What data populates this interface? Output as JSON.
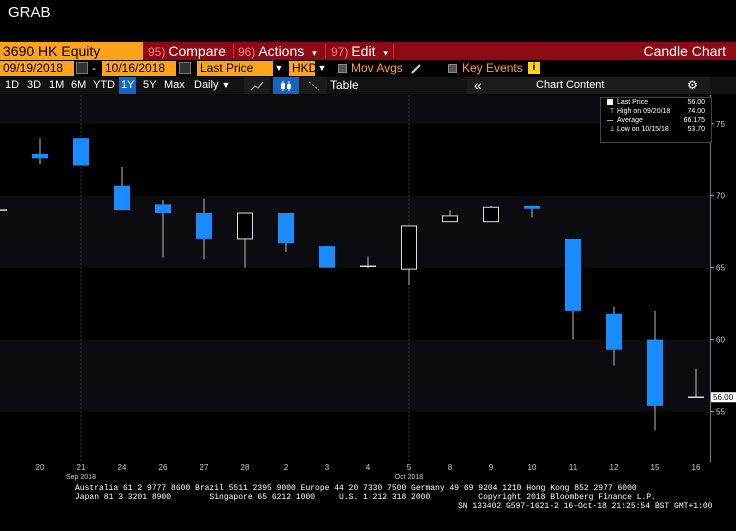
{
  "window": {
    "title": "GRAB"
  },
  "toolbar": {
    "ticker": "3690 HK Equity",
    "menus": [
      {
        "num": "95)",
        "label": "Compare"
      },
      {
        "num": "96)",
        "label": "Actions",
        "caret": "▾"
      },
      {
        "num": "97)",
        "label": "Edit",
        "caret": "▾"
      }
    ],
    "chart_type": "Candle Chart"
  },
  "settings": {
    "start_date": "09/19/2018",
    "end_date": "10/16/2018",
    "date_sep": "-",
    "field": "Last Price",
    "currency": "HKD",
    "mov_avgs": "Mov Avgs",
    "key_events": "Key Events",
    "info_icon": "i"
  },
  "periods": [
    "1D",
    "3D",
    "1M",
    "6M",
    "YTD",
    "1Y",
    "5Y",
    "Max"
  ],
  "selected_period": "1Y",
  "frequency": "Daily",
  "frequency_caret": "▼",
  "table_label": "Table",
  "collapse_icon": "«",
  "chart_content": "Chart Content",
  "gear_icon": "⚙",
  "legend": {
    "rows": [
      {
        "label": "Last Price",
        "value": "56.00"
      },
      {
        "label": "High on 09/20/18",
        "value": "74.00"
      },
      {
        "label": "Average",
        "value": "66.175"
      },
      {
        "label": "Low on 10/15/18",
        "value": "53.70"
      }
    ]
  },
  "chart_data": {
    "type": "candlestick",
    "currency": "HKD",
    "ylim": [
      51.5,
      77
    ],
    "yticks": [
      55,
      60,
      65,
      70,
      75
    ],
    "last_price_label": "56.00",
    "month_labels": [
      {
        "label": "Sep 2018",
        "at_index": 2
      },
      {
        "label": "Oct 2018",
        "at_index": 10
      }
    ],
    "candles": [
      {
        "x": "19",
        "open": 69.0,
        "close": 69.0,
        "high": 69.0,
        "low": 69.0,
        "color": "flat"
      },
      {
        "x": "20",
        "open": 72.9,
        "close": 72.6,
        "high": 74.0,
        "low": 72.2,
        "color": "blue"
      },
      {
        "x": "21",
        "open": 74.0,
        "close": 72.1,
        "high": 74.0,
        "low": 72.1,
        "color": "blue"
      },
      {
        "x": "24",
        "open": 70.7,
        "close": 69.0,
        "high": 72.0,
        "low": 69.0,
        "color": "blue"
      },
      {
        "x": "26",
        "open": 69.4,
        "close": 68.8,
        "high": 69.7,
        "low": 65.7,
        "color": "blue"
      },
      {
        "x": "27",
        "open": 68.8,
        "close": 67.0,
        "high": 69.8,
        "low": 65.6,
        "color": "blue"
      },
      {
        "x": "28",
        "open": 67.0,
        "close": 68.8,
        "high": 68.8,
        "low": 65.0,
        "color": "white"
      },
      {
        "x": "2",
        "open": 68.8,
        "close": 66.7,
        "high": 68.8,
        "low": 66.1,
        "color": "blue"
      },
      {
        "x": "3",
        "open": 66.5,
        "close": 65.0,
        "high": 66.5,
        "low": 65.0,
        "color": "blue"
      },
      {
        "x": "4",
        "open": 65.1,
        "close": 65.1,
        "high": 65.8,
        "low": 65.0,
        "color": "flat"
      },
      {
        "x": "5",
        "open": 64.9,
        "close": 67.9,
        "high": 67.9,
        "low": 63.8,
        "color": "white"
      },
      {
        "x": "8",
        "open": 68.2,
        "close": 68.6,
        "high": 69.0,
        "low": 68.2,
        "color": "white"
      },
      {
        "x": "9",
        "open": 68.2,
        "close": 69.2,
        "high": 69.3,
        "low": 68.2,
        "color": "white"
      },
      {
        "x": "10",
        "open": 69.3,
        "close": 69.1,
        "high": 69.3,
        "low": 68.5,
        "color": "blue"
      },
      {
        "x": "11",
        "open": 67.0,
        "close": 62.0,
        "high": 67.0,
        "low": 60.0,
        "color": "blue"
      },
      {
        "x": "12",
        "open": 61.8,
        "close": 59.3,
        "high": 62.3,
        "low": 58.2,
        "color": "blue"
      },
      {
        "x": "15",
        "open": 60.0,
        "close": 55.4,
        "high": 62.0,
        "low": 53.7,
        "color": "blue"
      },
      {
        "x": "16",
        "open": 56.0,
        "close": 56.0,
        "high": 58.0,
        "low": 56.0,
        "color": "flat"
      }
    ]
  },
  "colors": {
    "blue": "#1a8cff",
    "orange": "#ffa31a",
    "maroon": "#8b0a14"
  },
  "footer": {
    "line1": "Australia 61 2 9777 8600 Brazil 5511 2395 9000 Europe 44 20 7330 7500 Germany 49 69 9204 1210 Hong Kong 852 2977 6000",
    "line2": "Japan 81 3 3201 8900        Singapore 65 6212 1000     U.S. 1 212 318 2000          Copyright 2018 Bloomberg Finance L.P.",
    "line3": "SN 133402 G597-1621-2 16-Oct-18 21:25:54 BST  GMT+1:00"
  }
}
